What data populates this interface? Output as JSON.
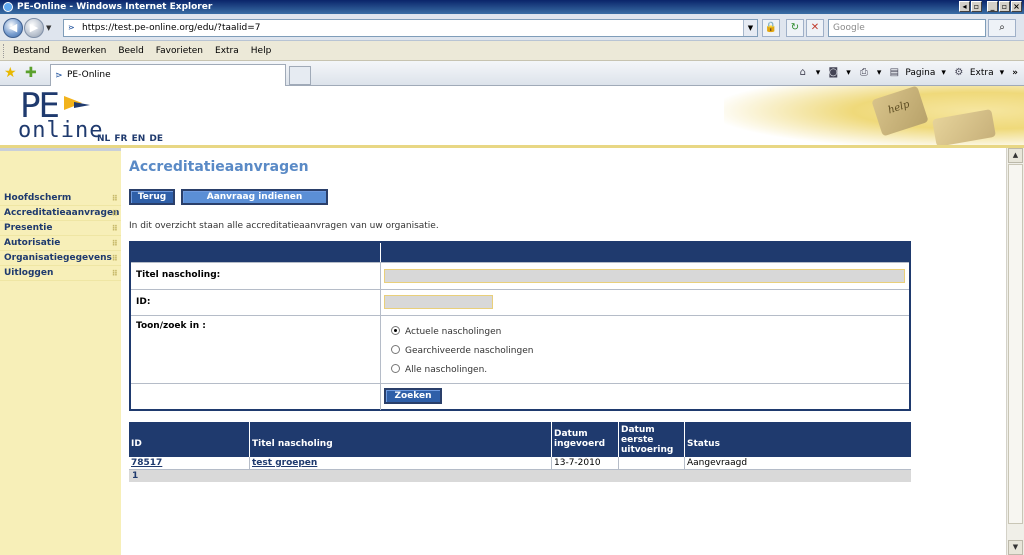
{
  "window": {
    "title": "PE-Online - Windows Internet Explorer"
  },
  "address": {
    "url": "https://test.pe-online.org/edu/?taalid=7",
    "search_placeholder": "Google"
  },
  "menu": [
    "Bestand",
    "Bewerken",
    "Beeld",
    "Favorieten",
    "Extra",
    "Help"
  ],
  "tab": {
    "title": "PE-Online"
  },
  "toolbar": {
    "page_label": "Pagina",
    "tools_label": "Extra"
  },
  "logo": {
    "pe": "PE",
    "online": "online"
  },
  "languages": "NL FR EN DE",
  "banner_key_text": "help",
  "sidebar": {
    "items": [
      {
        "label": "Hoofdscherm"
      },
      {
        "label": "Accreditatieaanvragen"
      },
      {
        "label": "Presentie"
      },
      {
        "label": "Autorisatie"
      },
      {
        "label": "Organisatiegegevens"
      },
      {
        "label": "Uitloggen"
      }
    ]
  },
  "page": {
    "title": "Accreditatieaanvragen",
    "back_button": "Terug",
    "submit_button": "Aanvraag indienen",
    "intro": "In dit overzicht staan alle accreditatieaanvragen van uw organisatie."
  },
  "form": {
    "title_label": "Titel nascholing:",
    "title_value": "",
    "id_label": "ID:",
    "id_value": "",
    "scope_label": "Toon/zoek in :",
    "options": [
      {
        "label": "Actuele nascholingen",
        "selected": true
      },
      {
        "label": "Gearchiveerde nascholingen",
        "selected": false
      },
      {
        "label": "Alle nascholingen.",
        "selected": false
      }
    ],
    "search_button": "Zoeken"
  },
  "results": {
    "headers": [
      "ID",
      "Titel nascholing",
      "Datum ingevoerd",
      "Datum eerste uitvoering",
      "Status"
    ],
    "rows": [
      [
        "78517",
        "test groepen",
        "13-7-2010",
        "",
        "Aangevraagd"
      ]
    ],
    "page": "1"
  },
  "colors": {
    "navy": "#1f3a6e",
    "title_blue": "#5a8ac6",
    "sidebar_yellow": "#f7efb8",
    "button_blue": "#2f5fa8"
  }
}
